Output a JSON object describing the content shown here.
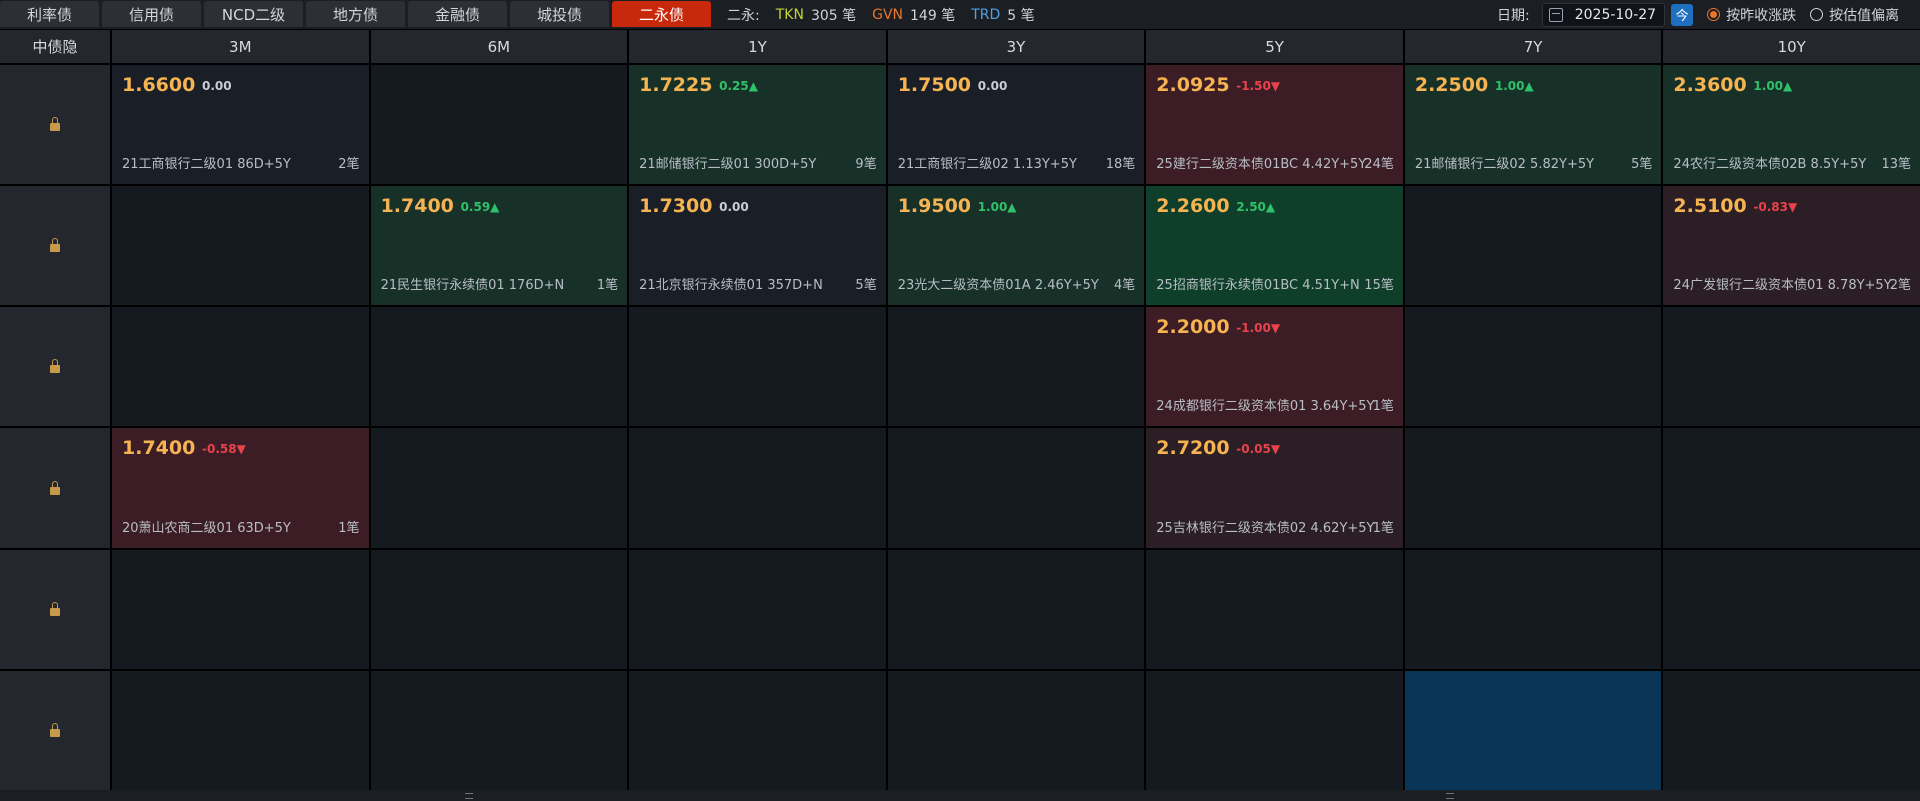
{
  "tabs": [
    {
      "label": "利率债",
      "active": false
    },
    {
      "label": "信用债",
      "active": false
    },
    {
      "label": "NCD二级",
      "active": false
    },
    {
      "label": "地方债",
      "active": false
    },
    {
      "label": "金融债",
      "active": false
    },
    {
      "label": "城投债",
      "active": false
    },
    {
      "label": "二永债",
      "active": true
    }
  ],
  "stats": {
    "label": "二永:",
    "tkn": {
      "name": "TKN",
      "count": "305 笔"
    },
    "gvn": {
      "name": "GVN",
      "count": "149 笔"
    },
    "trd": {
      "name": "TRD",
      "count": "5 笔"
    }
  },
  "date": {
    "label": "日期:",
    "value": "2025-10-27",
    "today_label": "今"
  },
  "options": [
    {
      "label": "按昨收涨跌",
      "selected": true
    },
    {
      "label": "按估值偏离",
      "selected": false
    }
  ],
  "corner_label": "中债隐",
  "columns": [
    "3M",
    "6M",
    "1Y",
    "3Y",
    "5Y",
    "7Y",
    "10Y"
  ],
  "colors": {
    "up": "#2fc169",
    "down": "#e8424c",
    "price": "#f5b451",
    "active_tab": "#c8290d",
    "selected_cell": "#093557"
  },
  "rows": [
    [
      {
        "price": "1.6600",
        "change": "0.00",
        "dir": "flat",
        "name": "21工商银行二级01 86D+5Y",
        "count": "2笔",
        "style": "flat"
      },
      null,
      {
        "price": "1.7225",
        "change": "0.25▲",
        "dir": "up",
        "name": "21邮储银行二级01 300D+5Y",
        "count": "9笔",
        "style": "up"
      },
      {
        "price": "1.7500",
        "change": "0.00",
        "dir": "flat",
        "name": "21工商银行二级02 1.13Y+5Y",
        "count": "18笔",
        "style": "flat"
      },
      {
        "price": "2.0925",
        "change": "-1.50▼",
        "dir": "down",
        "name": "25建行二级资本债01BC 4.42Y+5Y",
        "count": "24笔",
        "style": "down"
      },
      {
        "price": "2.2500",
        "change": "1.00▲",
        "dir": "up",
        "name": "21邮储银行二级02 5.82Y+5Y",
        "count": "5笔",
        "style": "up"
      },
      {
        "price": "2.3600",
        "change": "1.00▲",
        "dir": "up",
        "name": "24农行二级资本债02B 8.5Y+5Y",
        "count": "13笔",
        "style": "up"
      }
    ],
    [
      null,
      {
        "price": "1.7400",
        "change": "0.59▲",
        "dir": "up",
        "name": "21民生银行永续债01 176D+N",
        "count": "1笔",
        "style": "up"
      },
      {
        "price": "1.7300",
        "change": "0.00",
        "dir": "flat",
        "name": "21北京银行永续债01 357D+N",
        "count": "5笔",
        "style": "flat"
      },
      {
        "price": "1.9500",
        "change": "1.00▲",
        "dir": "up",
        "name": "23光大二级资本债01A 2.46Y+5Y",
        "count": "4笔",
        "style": "up"
      },
      {
        "price": "2.2600",
        "change": "2.50▲",
        "dir": "up",
        "name": "25招商银行永续债01BC 4.51Y+N",
        "count": "15笔",
        "style": "up2"
      },
      null,
      {
        "price": "2.5100",
        "change": "-0.83▼",
        "dir": "down",
        "name": "24广发银行二级资本债01 8.78Y+5Y",
        "count": "2笔",
        "style": "down2"
      }
    ],
    [
      null,
      null,
      null,
      null,
      {
        "price": "2.2000",
        "change": "-1.00▼",
        "dir": "down",
        "name": "24成都银行二级资本债01 3.64Y+5Y",
        "count": "1笔",
        "style": "down"
      },
      null,
      null
    ],
    [
      {
        "price": "1.7400",
        "change": "-0.58▼",
        "dir": "down",
        "name": "20萧山农商二级01 63D+5Y",
        "count": "1笔",
        "style": "down"
      },
      null,
      null,
      null,
      {
        "price": "2.7200",
        "change": "-0.05▼",
        "dir": "down",
        "name": "25吉林银行二级资本债02 4.62Y+5Y",
        "count": "1笔",
        "style": "down2"
      },
      null,
      null
    ],
    [
      null,
      null,
      null,
      null,
      null,
      null,
      null
    ],
    [
      null,
      null,
      null,
      null,
      null,
      {
        "selected": true
      },
      null
    ]
  ]
}
